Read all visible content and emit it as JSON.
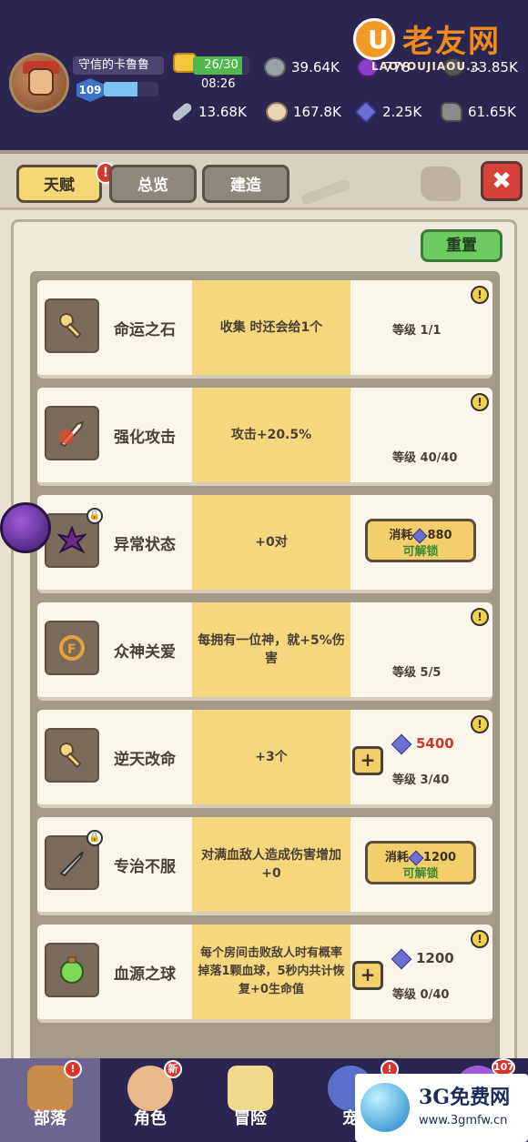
{
  "player": {
    "name": "守信的卡鲁鲁",
    "level": "109",
    "xp_fraction": 0.62
  },
  "energy": {
    "text": "26/30",
    "timer": "08:26",
    "fraction": 0.87
  },
  "resources_row1": [
    {
      "icon": "stone-icon",
      "value": "39.64K"
    },
    {
      "icon": "purple-orb-icon",
      "value": "778"
    },
    {
      "icon": "dark-resource-icon",
      "value": "33.85K"
    }
  ],
  "resources_row2": [
    {
      "icon": "bone-icon",
      "value": "13.68K"
    },
    {
      "icon": "coin-icon",
      "value": "167.8K"
    },
    {
      "icon": "gem-icon",
      "value": "2.25K"
    },
    {
      "icon": "rock-icon",
      "value": "61.65K"
    }
  ],
  "watermark_top": {
    "logo_letter": "U",
    "text": "老友网",
    "sub": "LAOYOUJIAOU..."
  },
  "tabs": {
    "talent": "天赋",
    "overview": "总览",
    "build": "建造",
    "alert": "!"
  },
  "close_label": "✖",
  "reset_label": "重置",
  "talents": [
    {
      "name": "命运之石",
      "desc": "收集 时还会给1个",
      "level": "等级 1/1",
      "state": "maxed",
      "icon": "key-icon"
    },
    {
      "name": "强化攻击",
      "desc": "攻击+20.5%",
      "level": "等级 40/40",
      "state": "maxed",
      "icon": "sword-fire-icon"
    },
    {
      "name": "异常状态",
      "desc": "+0对",
      "state": "locked",
      "icon": "status-burst-icon",
      "cost_prefix": "消耗",
      "cost": "880",
      "unlock": "可解锁"
    },
    {
      "name": "众神关爱",
      "desc": "每拥有一位神，就+5%伤害",
      "level": "等级 5/5",
      "state": "maxed",
      "icon": "divine-ring-icon"
    },
    {
      "name": "逆天改命",
      "desc": "+3个",
      "level": "等级 3/40",
      "state": "upgrade",
      "icon": "key-level-icon",
      "cost": "5400",
      "cost_color": "#c8382e",
      "plus": "+"
    },
    {
      "name": "专治不服",
      "desc": "对满血敌人造成伤害增加+0",
      "state": "locked",
      "icon": "dagger-icon",
      "cost_prefix": "消耗",
      "cost": "1200",
      "unlock": "可解锁"
    },
    {
      "name": "血源之球",
      "desc": "每个房间击败敌人时有概率掉落1颗血球，5秒内共计恢复+0生命值",
      "level": "等级 0/40",
      "state": "upgrade",
      "icon": "green-orb-icon",
      "cost": "1200",
      "cost_color": "#4a3f35",
      "plus": "+"
    }
  ],
  "info_mark": "!",
  "nav": [
    {
      "label": "部落",
      "icon": "tribe-icon",
      "badge": "!"
    },
    {
      "label": "角色",
      "icon": "character-icon",
      "badge": "新"
    },
    {
      "label": "冒险",
      "icon": "map-icon",
      "badge": ""
    },
    {
      "label": "宠",
      "icon": "pet-icon",
      "badge": "!"
    },
    {
      "label": "",
      "icon": "shop-icon",
      "badge": "107"
    }
  ],
  "watermark_bottom": {
    "title": "3G免费网",
    "url": "www.3gmfw.cn"
  }
}
